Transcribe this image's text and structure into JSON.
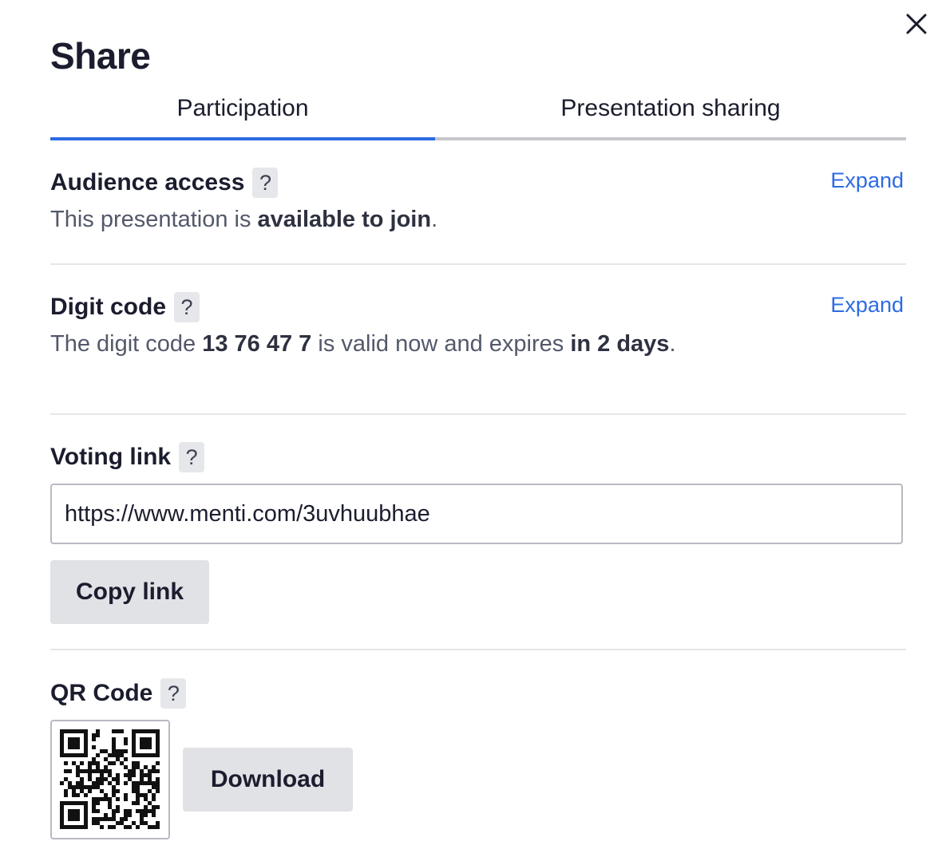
{
  "dialog": {
    "title": "Share",
    "close_icon": "close-icon"
  },
  "tabs": [
    {
      "label": "Participation",
      "active": true
    },
    {
      "label": "Presentation sharing",
      "active": false
    }
  ],
  "audience_access": {
    "title": "Audience access",
    "help": "?",
    "expand": "Expand",
    "text_prefix": "This presentation is ",
    "text_bold": "available to join",
    "text_suffix": "."
  },
  "digit_code": {
    "title": "Digit code",
    "help": "?",
    "expand": "Expand",
    "text_prefix": "The digit code ",
    "code": "13 76 47 7",
    "text_middle": " is valid now and expires ",
    "expires": "in 2 days",
    "text_suffix": "."
  },
  "voting_link": {
    "title": "Voting link",
    "help": "?",
    "url": "https://www.menti.com/3uvhuubhae",
    "copy_label": "Copy link"
  },
  "qr_code": {
    "title": "QR Code",
    "help": "?",
    "download_label": "Download"
  },
  "colors": {
    "accent": "#2d6be4",
    "text": "#1b1d2e",
    "button_bg": "#e1e2e6"
  }
}
